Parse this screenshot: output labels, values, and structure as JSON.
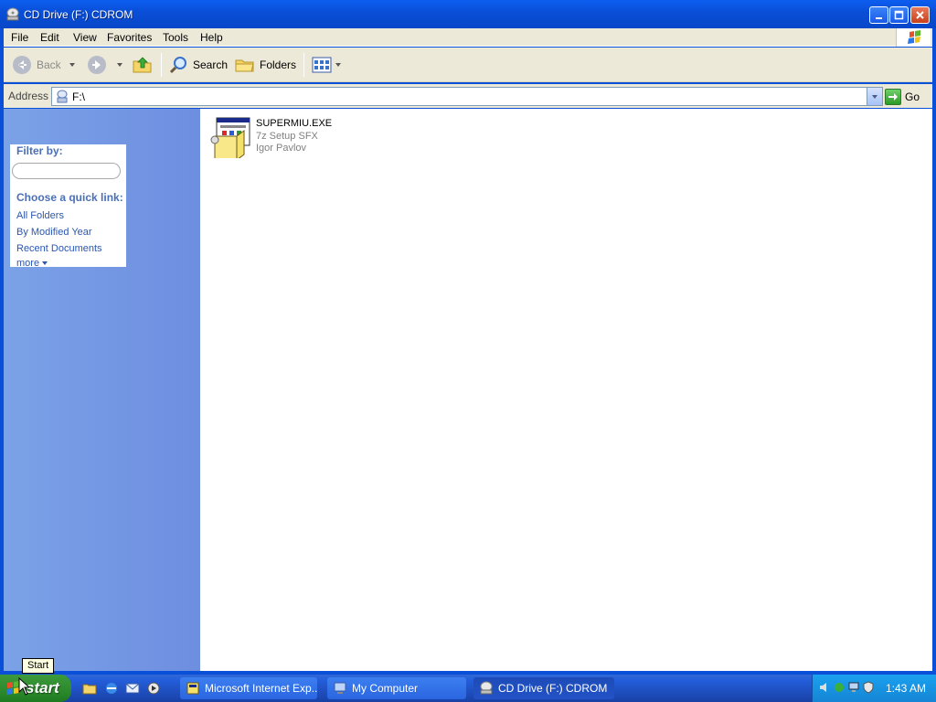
{
  "window": {
    "title": "CD Drive (F:) CDROM"
  },
  "menu": {
    "items": [
      "File",
      "Edit",
      "View",
      "Favorites",
      "Tools",
      "Help"
    ]
  },
  "toolbar": {
    "back_label": "Back",
    "search_label": "Search",
    "folders_label": "Folders"
  },
  "address": {
    "label": "Address",
    "value": "F:\\",
    "go_label": "Go"
  },
  "left_pane": {
    "filter_heading": "Filter by:",
    "filter_placeholder": "",
    "quick_link_heading": "Choose a quick link:",
    "links": [
      "All Folders",
      "By Modified Year",
      "Recent Documents"
    ],
    "more_label": "more"
  },
  "files": [
    {
      "name": "SUPERMIU.EXE",
      "description": "7z Setup SFX",
      "company": "Igor Pavlov"
    }
  ],
  "taskbar": {
    "start_label": "start",
    "start_tooltip": "Start",
    "tasks": [
      {
        "label": "Microsoft Internet Exp...",
        "active": false
      },
      {
        "label": "My Computer",
        "active": false
      },
      {
        "label": "CD Drive (F:) CDROM",
        "active": true
      }
    ],
    "clock": "1:43 AM"
  },
  "colors": {
    "titlebar": "#0a4fd8",
    "taskpane": "#7ba2e7",
    "taskbar": "#245edb",
    "start_button": "#2c8a2c"
  }
}
